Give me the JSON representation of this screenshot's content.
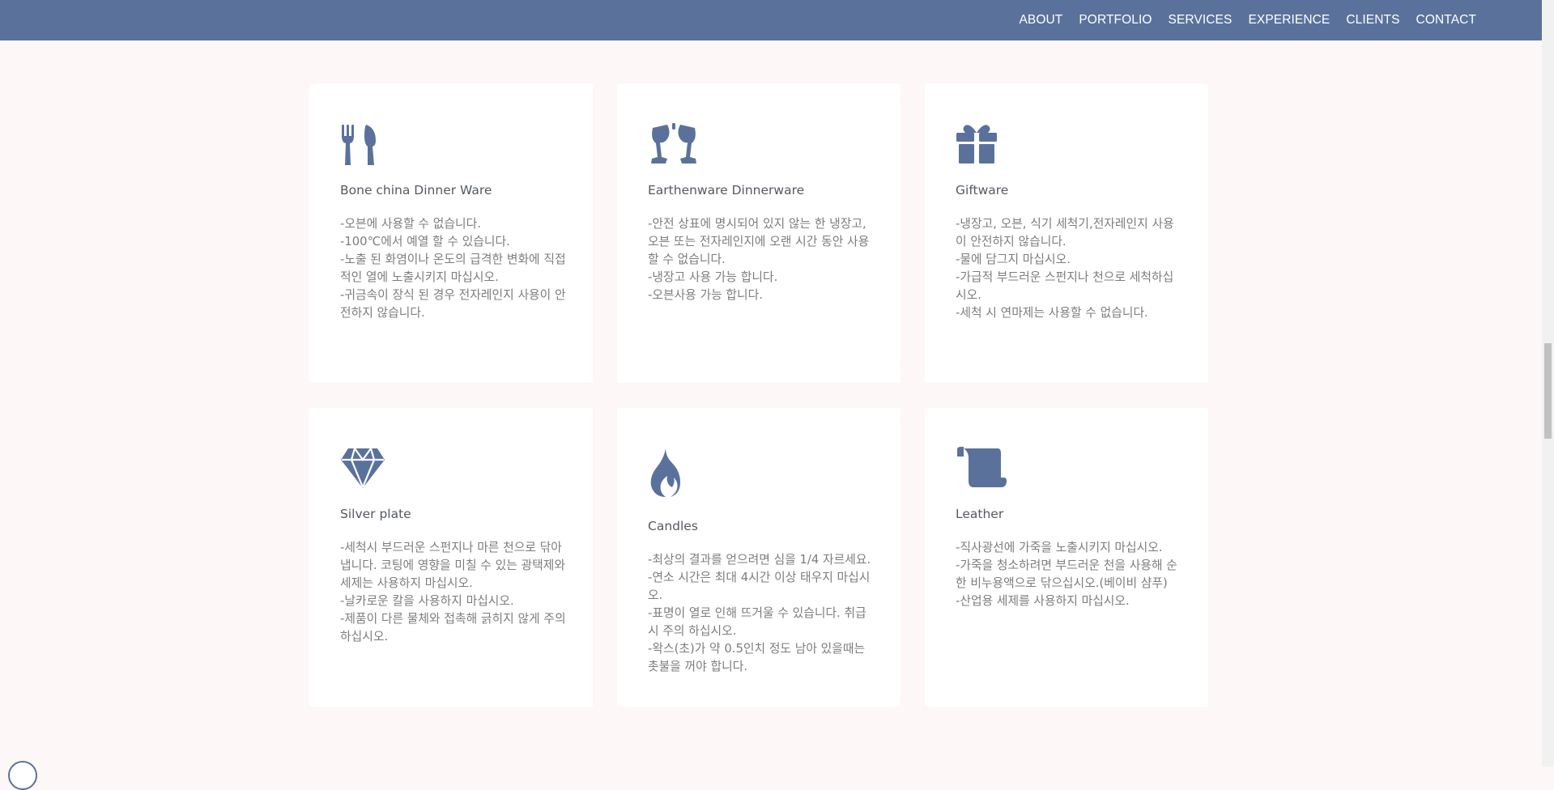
{
  "nav": {
    "items": [
      "ABOUT",
      "PORTFOLIO",
      "SERVICES",
      "EXPERIENCE",
      "CLIENTS",
      "CONTACT"
    ]
  },
  "colors": {
    "nav_bg": "#5a729b",
    "icon": "#5a729b",
    "page_bg": "#fdf7f7",
    "card_bg": "#ffffff"
  },
  "cards": [
    {
      "icon": "fork-knife-icon",
      "title": "Bone china Dinner Ware",
      "lines": [
        "-오븐에 사용할 수 없습니다.",
        "-100℃에서 예열 할 수 있습니다.",
        "-노출 된 화염이나 온도의 급격한 변화에 직접적인 열에 노출시키지 마십시오.",
        "-귀금속이 장식 된 경우 전자레인지 사용이 안전하지 않습니다."
      ]
    },
    {
      "icon": "wine-glasses-icon",
      "title": "Earthenware Dinnerware",
      "lines": [
        "-안전 상표에 명시되어 있지 않는 한 냉장고, 오븐 또는 전자레인지에 오랜 시간 동안 사용할 수 없습니다.",
        "-냉장고 사용 가능 합니다.",
        "-오븐사용 가능 합니다."
      ]
    },
    {
      "icon": "gift-icon",
      "title": "Giftware",
      "lines": [
        "-냉장고, 오븐, 식기 세척기,전자레인지 사용이 안전하지 않습니다.",
        "-물에 담그지 마십시오.",
        "-가급적 부드러운 스펀지나 천으로 세척하십시오.",
        "-세척 시 연마제는 사용할 수 없습니다."
      ]
    },
    {
      "icon": "diamond-icon",
      "title": "Silver plate",
      "lines": [
        "-세척시 부드러운 스펀지나 마른 천으로 닦아냅니다. 코팅에 영향을 미칠 수 있는 광택제와 세제는 사용하지 마십시오.",
        "-날카로운 칼을 사용하지 마십시오.",
        "-제품이 다른 물체와 접촉해 긁히지 않게 주의 하십시오."
      ]
    },
    {
      "icon": "flame-icon",
      "title": "Candles",
      "lines": [
        "-최상의 결과를 얻으려면 심을 1/4 자르세요.",
        "-연소 시간은 최대 4시간 이상 태우지 마십시오.",
        "-표명이 열로 인해 뜨거울 수 있습니다. 취급시 주의 하십시오.",
        "-왁스(초)가 약 0.5인치 정도 남아 있을때는 촛불을 꺼야 합니다."
      ]
    },
    {
      "icon": "scroll-icon",
      "title": "Leather",
      "lines": [
        "-직사광선에 가죽을 노출시키지 마십시오.",
        "-가죽을 청소하려면 부드러운 천을 사용해 순한 비누용액으로 닦으십시오.(베이비 샴푸)",
        "-산업용 세제를 사용하지 마십시오."
      ]
    }
  ]
}
